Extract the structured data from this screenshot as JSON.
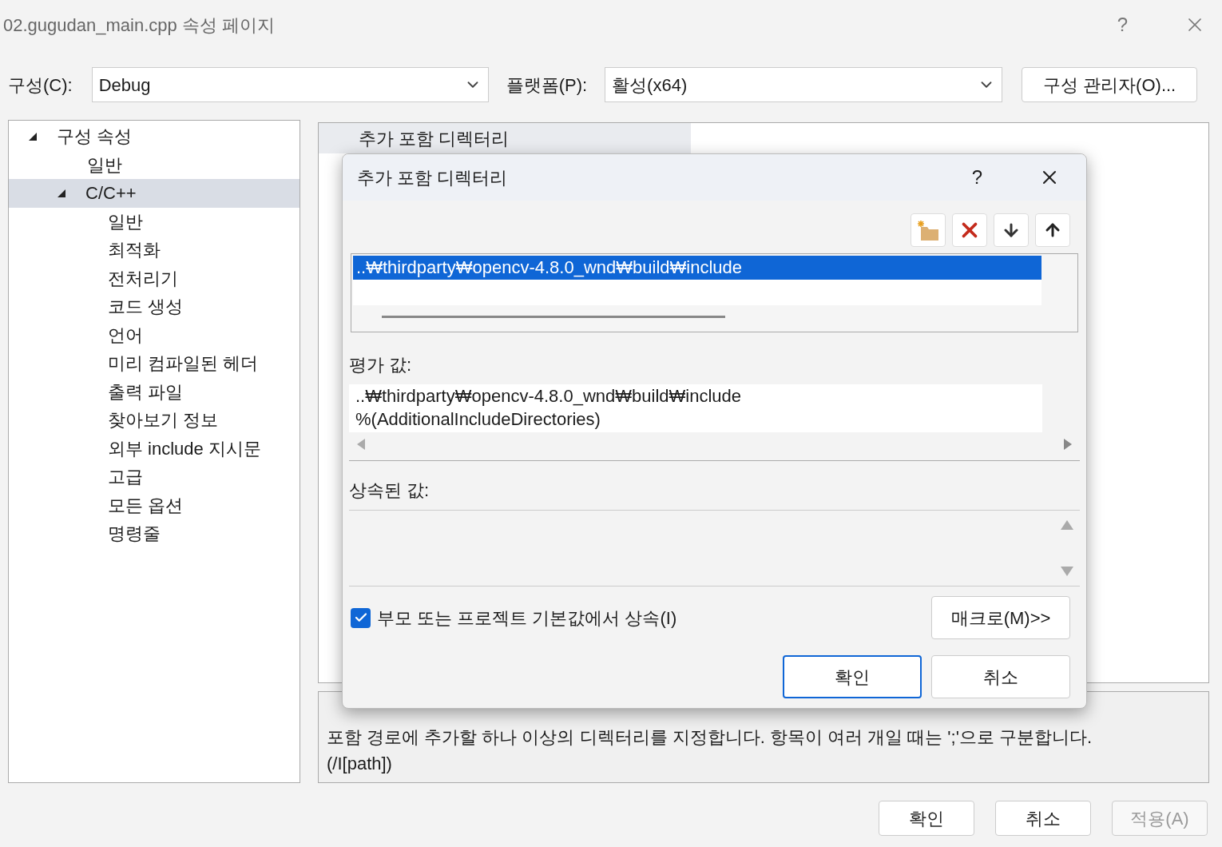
{
  "window": {
    "title": "02.gugudan_main.cpp 속성 페이지",
    "help": "?"
  },
  "config": {
    "label": "구성(C):",
    "value": "Debug"
  },
  "platform": {
    "label": "플랫폼(P):",
    "value": "활성(x64)"
  },
  "config_manager_button": "구성 관리자(O)...",
  "tree": [
    {
      "label": "구성 속성",
      "expanded": true,
      "selected": false,
      "children": [
        {
          "label": "일반",
          "selected": false
        },
        {
          "label": "C/C++",
          "expanded": true,
          "selected": true,
          "children": [
            {
              "label": "일반",
              "selected": false
            },
            {
              "label": "최적화",
              "selected": false
            },
            {
              "label": "전처리기",
              "selected": false
            },
            {
              "label": "코드 생성",
              "selected": false
            },
            {
              "label": "언어",
              "selected": false
            },
            {
              "label": "미리 컴파일된 헤더",
              "selected": false
            },
            {
              "label": "출력 파일",
              "selected": false
            },
            {
              "label": "찾아보기 정보",
              "selected": false
            },
            {
              "label": "외부 include 지시문",
              "selected": false
            },
            {
              "label": "고급",
              "selected": false
            },
            {
              "label": "모든 옵션",
              "selected": false
            },
            {
              "label": "명령줄",
              "selected": false
            }
          ]
        }
      ]
    }
  ],
  "property_grid": {
    "header": "추가 포함 디렉터리"
  },
  "description": {
    "text": "포함 경로에 추가할 하나 이상의 디렉터리를 지정합니다. 항목이 여러 개일 때는 ';'으로 구분합니다.",
    "switch": "(/I[path])"
  },
  "buttons": [
    {
      "label": "확인",
      "disabled": false
    },
    {
      "label": "취소",
      "disabled": false
    },
    {
      "label": "적용(A)",
      "disabled": true
    }
  ],
  "dialog": {
    "title": "추가 포함 디렉터리",
    "help": "?",
    "toolbar": [
      {
        "kind": "new-folder"
      },
      {
        "kind": "delete"
      },
      {
        "kind": "down"
      },
      {
        "kind": "up"
      }
    ],
    "entries": [
      {
        "text": "..₩thirdparty₩opencv-4.8.0_wnd₩build₩include",
        "selected": true
      }
    ],
    "evaluated_label": "평가 값:",
    "evaluated_lines": [
      "..₩thirdparty₩opencv-4.8.0_wnd₩build₩include",
      "%(AdditionalIncludeDirectories)"
    ],
    "inherited_label": "상속된 값:",
    "inherit": {
      "label": "부모 또는 프로젝트 기본값에서 상속(I)",
      "checked": true
    },
    "macros_button": "매크로(M)>>",
    "buttons": [
      {
        "label": "확인",
        "default": true
      },
      {
        "label": "취소",
        "default": false
      }
    ]
  }
}
